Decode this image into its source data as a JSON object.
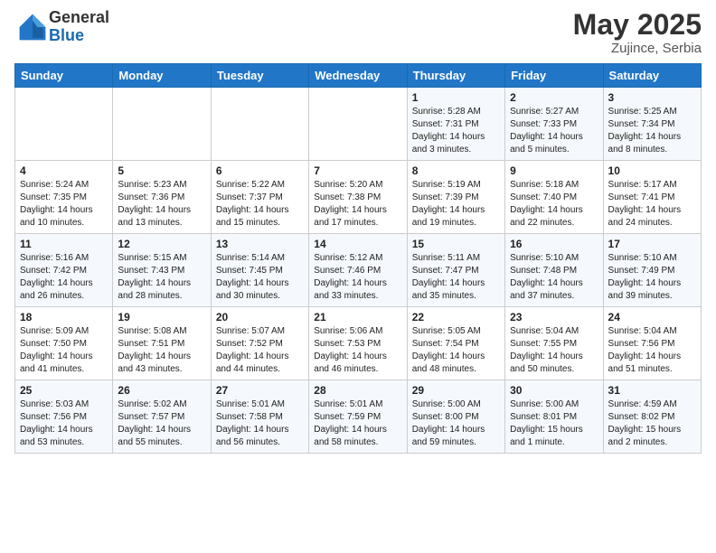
{
  "header": {
    "logo_general": "General",
    "logo_blue": "Blue",
    "month": "May 2025",
    "location": "Zujince, Serbia"
  },
  "weekdays": [
    "Sunday",
    "Monday",
    "Tuesday",
    "Wednesday",
    "Thursday",
    "Friday",
    "Saturday"
  ],
  "weeks": [
    [
      {
        "day": "",
        "content": ""
      },
      {
        "day": "",
        "content": ""
      },
      {
        "day": "",
        "content": ""
      },
      {
        "day": "",
        "content": ""
      },
      {
        "day": "1",
        "content": "Sunrise: 5:28 AM\nSunset: 7:31 PM\nDaylight: 14 hours\nand 3 minutes."
      },
      {
        "day": "2",
        "content": "Sunrise: 5:27 AM\nSunset: 7:33 PM\nDaylight: 14 hours\nand 5 minutes."
      },
      {
        "day": "3",
        "content": "Sunrise: 5:25 AM\nSunset: 7:34 PM\nDaylight: 14 hours\nand 8 minutes."
      }
    ],
    [
      {
        "day": "4",
        "content": "Sunrise: 5:24 AM\nSunset: 7:35 PM\nDaylight: 14 hours\nand 10 minutes."
      },
      {
        "day": "5",
        "content": "Sunrise: 5:23 AM\nSunset: 7:36 PM\nDaylight: 14 hours\nand 13 minutes."
      },
      {
        "day": "6",
        "content": "Sunrise: 5:22 AM\nSunset: 7:37 PM\nDaylight: 14 hours\nand 15 minutes."
      },
      {
        "day": "7",
        "content": "Sunrise: 5:20 AM\nSunset: 7:38 PM\nDaylight: 14 hours\nand 17 minutes."
      },
      {
        "day": "8",
        "content": "Sunrise: 5:19 AM\nSunset: 7:39 PM\nDaylight: 14 hours\nand 19 minutes."
      },
      {
        "day": "9",
        "content": "Sunrise: 5:18 AM\nSunset: 7:40 PM\nDaylight: 14 hours\nand 22 minutes."
      },
      {
        "day": "10",
        "content": "Sunrise: 5:17 AM\nSunset: 7:41 PM\nDaylight: 14 hours\nand 24 minutes."
      }
    ],
    [
      {
        "day": "11",
        "content": "Sunrise: 5:16 AM\nSunset: 7:42 PM\nDaylight: 14 hours\nand 26 minutes."
      },
      {
        "day": "12",
        "content": "Sunrise: 5:15 AM\nSunset: 7:43 PM\nDaylight: 14 hours\nand 28 minutes."
      },
      {
        "day": "13",
        "content": "Sunrise: 5:14 AM\nSunset: 7:45 PM\nDaylight: 14 hours\nand 30 minutes."
      },
      {
        "day": "14",
        "content": "Sunrise: 5:12 AM\nSunset: 7:46 PM\nDaylight: 14 hours\nand 33 minutes."
      },
      {
        "day": "15",
        "content": "Sunrise: 5:11 AM\nSunset: 7:47 PM\nDaylight: 14 hours\nand 35 minutes."
      },
      {
        "day": "16",
        "content": "Sunrise: 5:10 AM\nSunset: 7:48 PM\nDaylight: 14 hours\nand 37 minutes."
      },
      {
        "day": "17",
        "content": "Sunrise: 5:10 AM\nSunset: 7:49 PM\nDaylight: 14 hours\nand 39 minutes."
      }
    ],
    [
      {
        "day": "18",
        "content": "Sunrise: 5:09 AM\nSunset: 7:50 PM\nDaylight: 14 hours\nand 41 minutes."
      },
      {
        "day": "19",
        "content": "Sunrise: 5:08 AM\nSunset: 7:51 PM\nDaylight: 14 hours\nand 43 minutes."
      },
      {
        "day": "20",
        "content": "Sunrise: 5:07 AM\nSunset: 7:52 PM\nDaylight: 14 hours\nand 44 minutes."
      },
      {
        "day": "21",
        "content": "Sunrise: 5:06 AM\nSunset: 7:53 PM\nDaylight: 14 hours\nand 46 minutes."
      },
      {
        "day": "22",
        "content": "Sunrise: 5:05 AM\nSunset: 7:54 PM\nDaylight: 14 hours\nand 48 minutes."
      },
      {
        "day": "23",
        "content": "Sunrise: 5:04 AM\nSunset: 7:55 PM\nDaylight: 14 hours\nand 50 minutes."
      },
      {
        "day": "24",
        "content": "Sunrise: 5:04 AM\nSunset: 7:56 PM\nDaylight: 14 hours\nand 51 minutes."
      }
    ],
    [
      {
        "day": "25",
        "content": "Sunrise: 5:03 AM\nSunset: 7:56 PM\nDaylight: 14 hours\nand 53 minutes."
      },
      {
        "day": "26",
        "content": "Sunrise: 5:02 AM\nSunset: 7:57 PM\nDaylight: 14 hours\nand 55 minutes."
      },
      {
        "day": "27",
        "content": "Sunrise: 5:01 AM\nSunset: 7:58 PM\nDaylight: 14 hours\nand 56 minutes."
      },
      {
        "day": "28",
        "content": "Sunrise: 5:01 AM\nSunset: 7:59 PM\nDaylight: 14 hours\nand 58 minutes."
      },
      {
        "day": "29",
        "content": "Sunrise: 5:00 AM\nSunset: 8:00 PM\nDaylight: 14 hours\nand 59 minutes."
      },
      {
        "day": "30",
        "content": "Sunrise: 5:00 AM\nSunset: 8:01 PM\nDaylight: 15 hours\nand 1 minute."
      },
      {
        "day": "31",
        "content": "Sunrise: 4:59 AM\nSunset: 8:02 PM\nDaylight: 15 hours\nand 2 minutes."
      }
    ]
  ]
}
